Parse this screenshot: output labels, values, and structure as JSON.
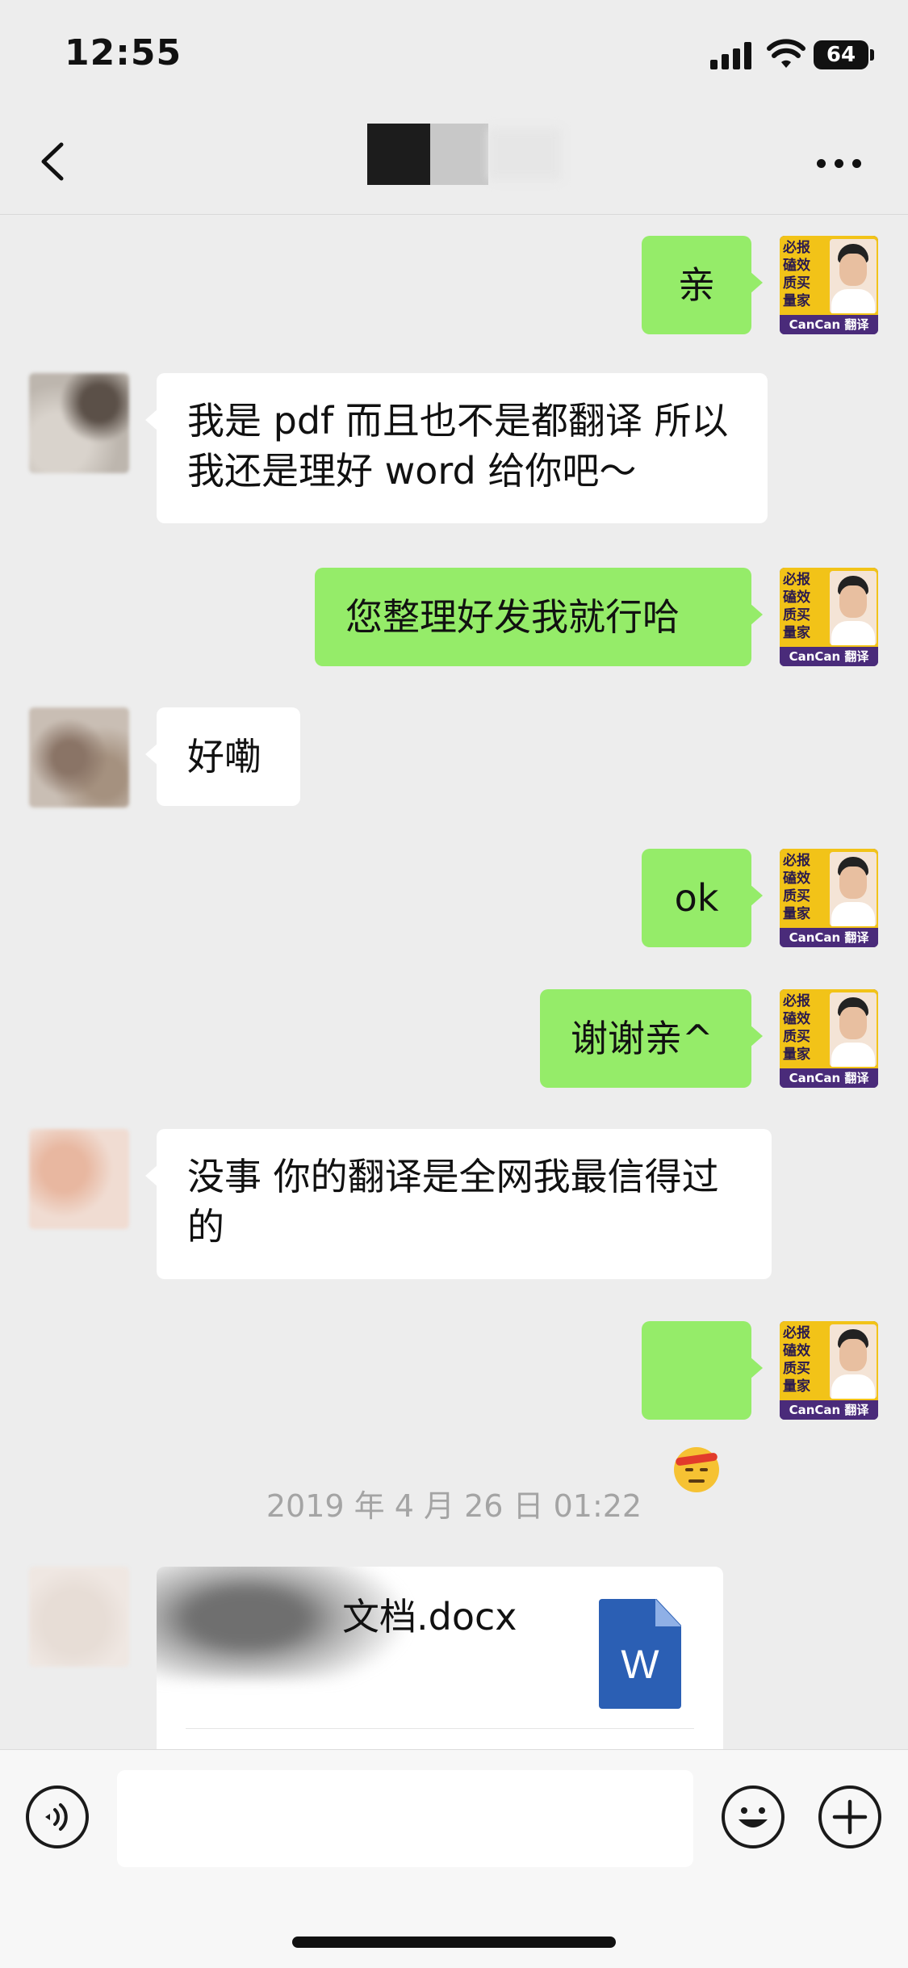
{
  "status_bar": {
    "time": "12:55",
    "battery": "64",
    "icons": [
      "signal-icon",
      "wifi-icon",
      "battery-icon"
    ]
  },
  "nav": {
    "back_icon": "chevron-left-icon",
    "more_icon": "more-dots-icon"
  },
  "avatars": {
    "self": {
      "chars": [
        "必",
        "报",
        "磕",
        "效",
        "质",
        "买",
        "量",
        "家"
      ],
      "brand": "CanCan 翻译"
    }
  },
  "messages": [
    {
      "side": "self",
      "text": "亲"
    },
    {
      "side": "peer",
      "text": "我是 pdf 而且也不是都翻译 所以我还是理好 word 给你吧～"
    },
    {
      "side": "self",
      "text": "您整理好发我就行哈"
    },
    {
      "side": "peer",
      "text": "好嘞"
    },
    {
      "side": "self",
      "text": "ok"
    },
    {
      "side": "self",
      "text": "谢谢亲^"
    },
    {
      "side": "peer",
      "text": "没事 你的翻译是全网我最信得过的"
    },
    {
      "side": "self",
      "emoji": "angry-headband-emoji"
    }
  ],
  "timestamp": "2019 年 4 月 26 日 01:22",
  "file_message": {
    "name": "文档.docx",
    "icon": "word-document-icon",
    "icon_letter": "W"
  },
  "input_bar": {
    "placeholder": "",
    "icons": [
      "voice-icon",
      "emoji-face-icon",
      "plus-icon"
    ]
  },
  "colors": {
    "background": "#ededed",
    "self_bubble": "#95ec69",
    "peer_bubble": "#ffffff",
    "word_blue": "#2b5fb4"
  }
}
